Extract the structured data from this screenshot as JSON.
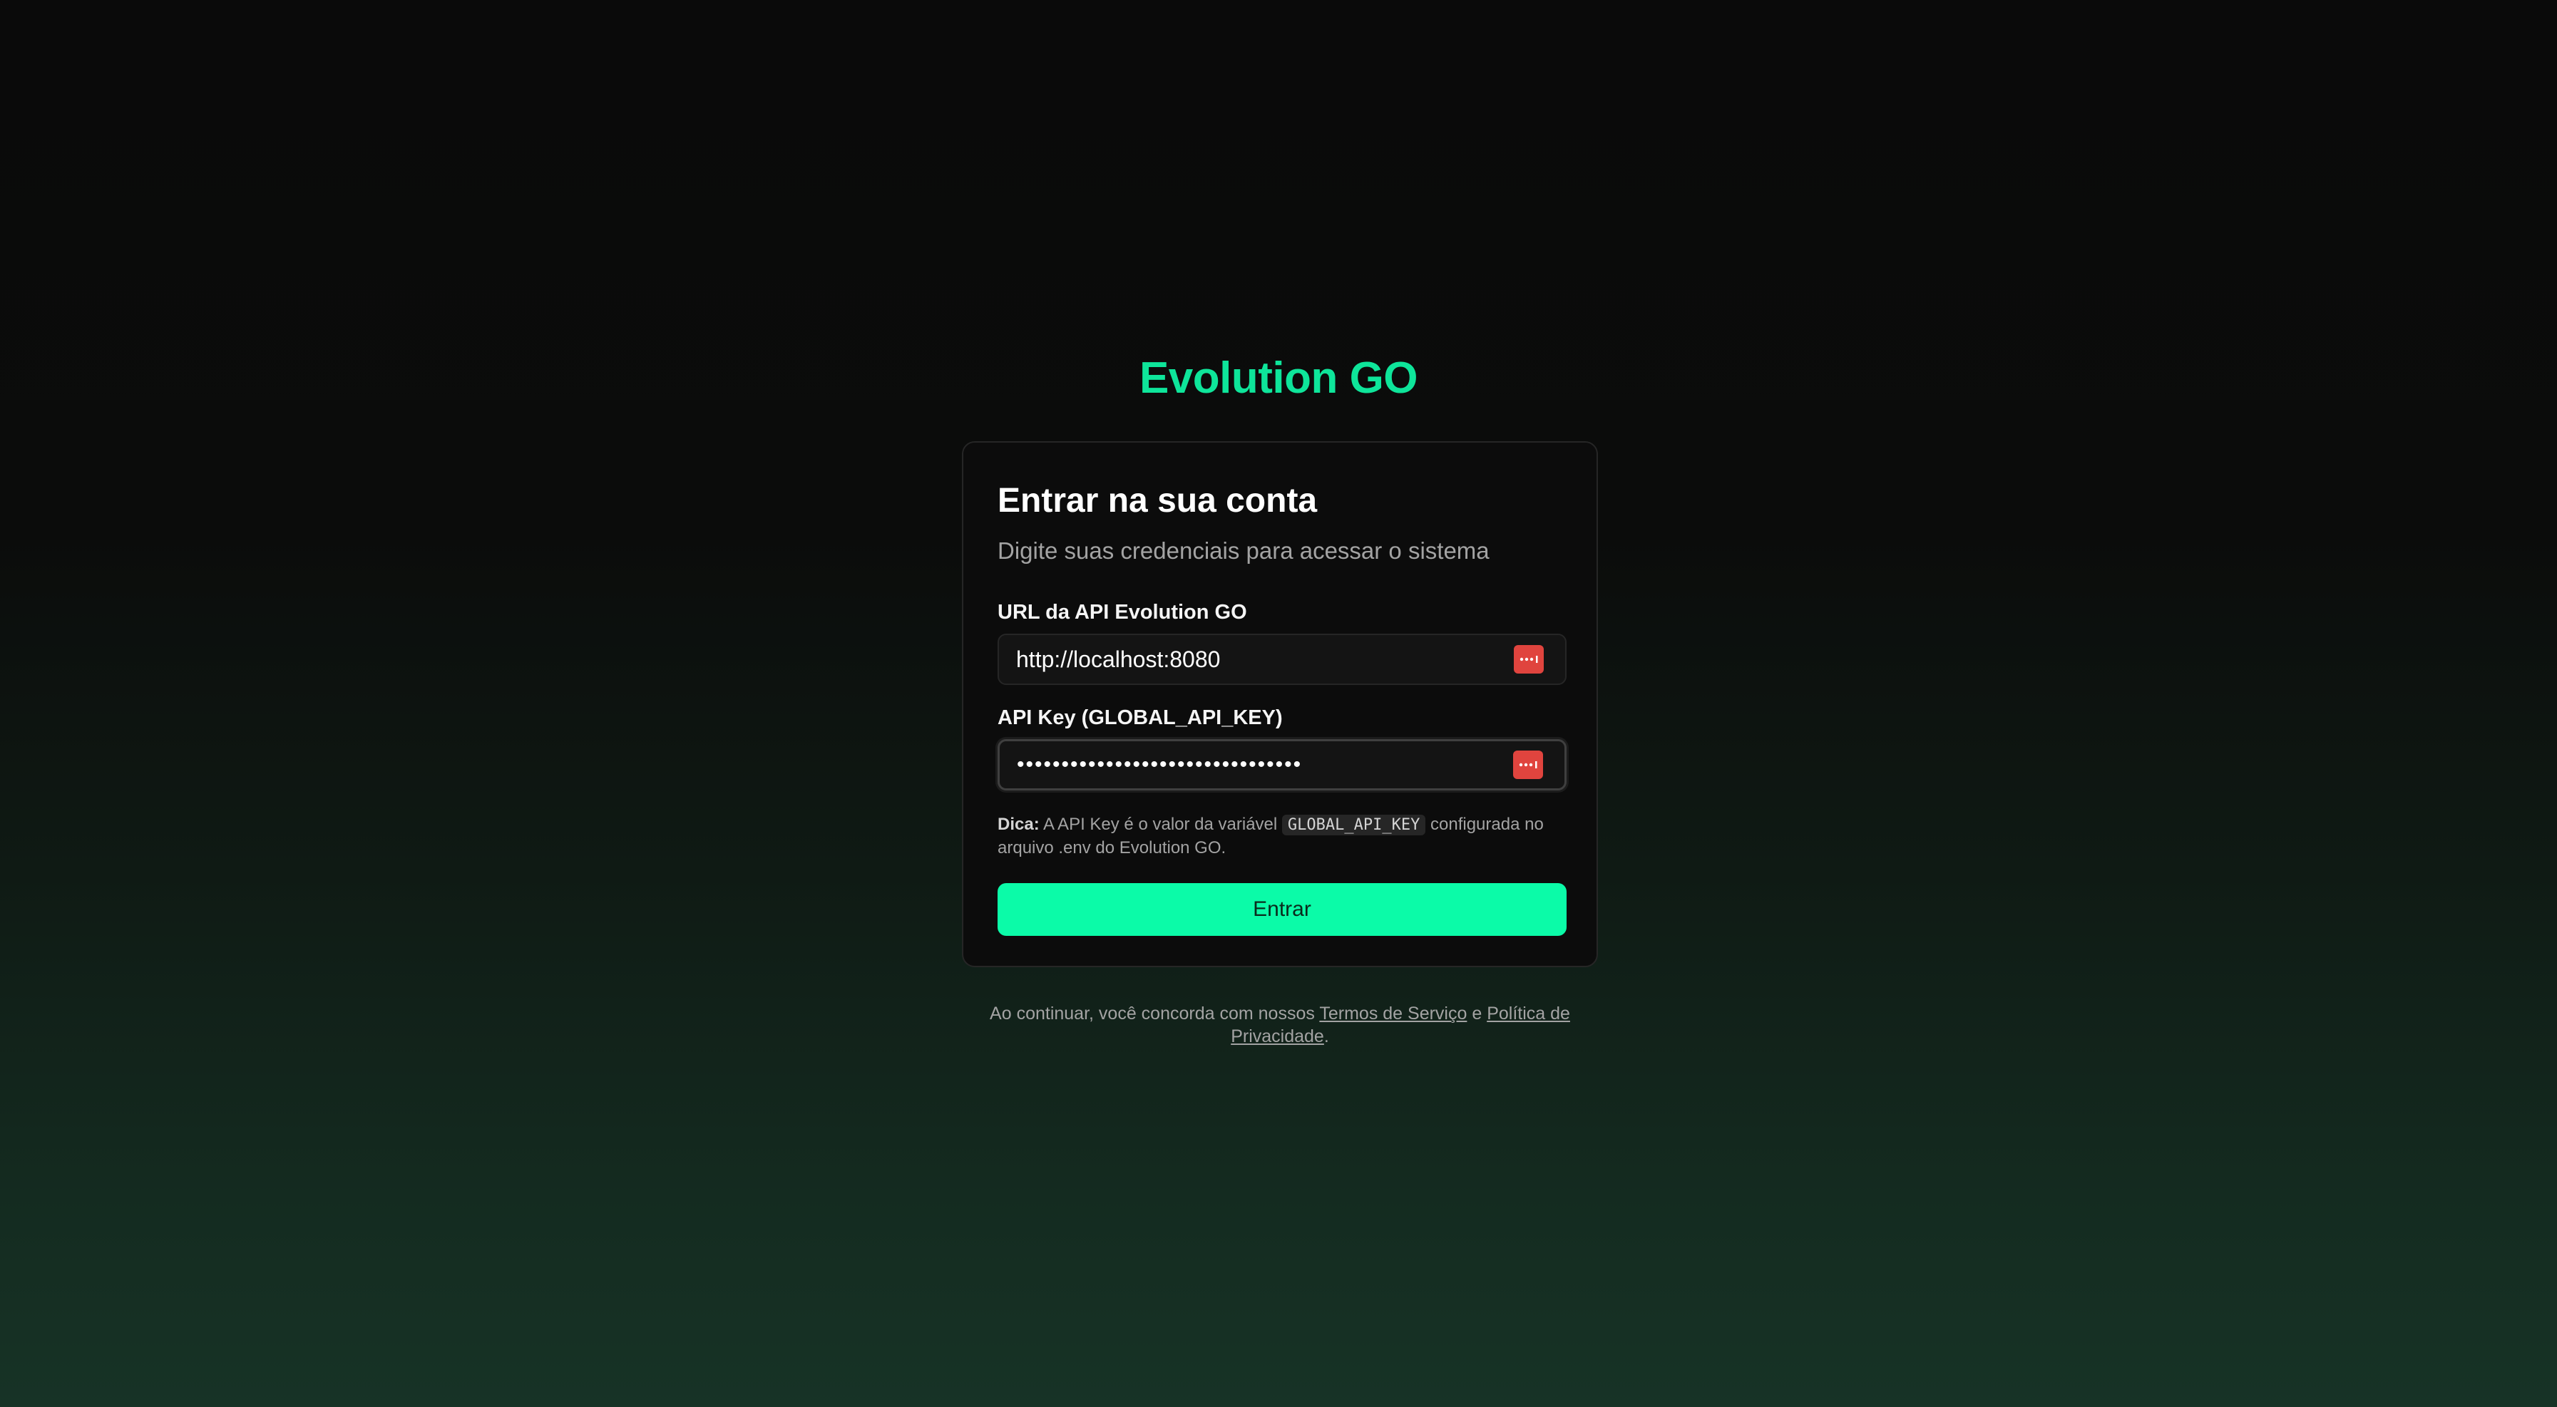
{
  "brand": {
    "title": "Evolution GO",
    "accent_color": "#0ee59a"
  },
  "card": {
    "title": "Entrar na sua conta",
    "subtitle": "Digite suas credenciais para acessar o sistema"
  },
  "fields": {
    "url": {
      "label": "URL da API Evolution GO",
      "value": "http://localhost:8080",
      "icon": "password-manager-icon"
    },
    "api_key": {
      "label": "API Key (GLOBAL_API_KEY)",
      "value": "••••••••••••••••••••••••••••••••",
      "icon": "password-manager-icon"
    }
  },
  "hint": {
    "prefix": "Dica:",
    "text_before": " A API Key é o valor da variável ",
    "code": "GLOBAL_API_KEY",
    "text_after": " configurada no arquivo .env do Evolution GO."
  },
  "submit": {
    "label": "Entrar",
    "color": "#0bfba8"
  },
  "footer": {
    "text_before": "Ao continuar, você concorda com nossos ",
    "terms_link": "Termos de Serviço",
    "conjunction": " e ",
    "privacy_link": "Política de Privacidade",
    "text_after": "."
  }
}
